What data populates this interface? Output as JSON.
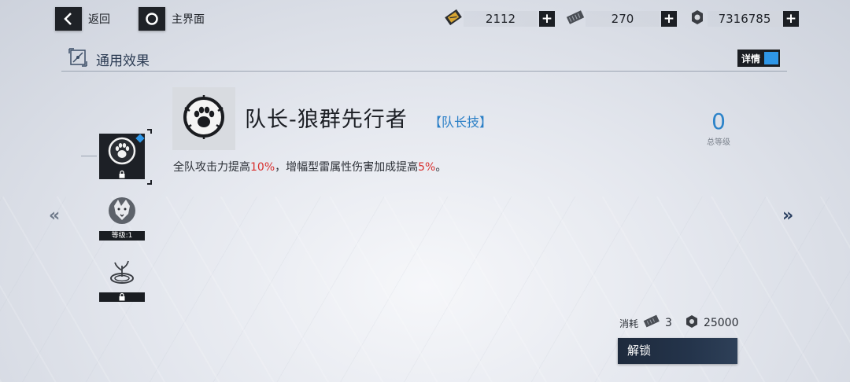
{
  "topbar": {
    "back_label": "返回",
    "home_label": "主界面",
    "resources": [
      {
        "icon": "ticket-icon",
        "value": "2112"
      },
      {
        "icon": "alloy-plate-icon",
        "value": "270"
      },
      {
        "icon": "gear-coin-icon",
        "value": "7316785"
      }
    ]
  },
  "section": {
    "title": "通用效果",
    "toggle_label": "详情"
  },
  "skill": {
    "name": "队长-狼群先行者",
    "tag": "【队长技】",
    "desc_parts": [
      "全队攻击力提高",
      "10%",
      "，增幅型雷属性伤害加成提高",
      "5%",
      "。"
    ],
    "level": "0",
    "level_label": "总等级"
  },
  "skill_list": [
    {
      "icon": "wolf-paw-icon",
      "state": "locked",
      "selected": true
    },
    {
      "icon": "wolf-head-icon",
      "state_label": "等级:1",
      "selected": false
    },
    {
      "icon": "sprout-ring-icon",
      "state": "locked",
      "selected": false
    }
  ],
  "nav": {
    "prev": "«",
    "next": "»"
  },
  "cost": {
    "label": "消耗",
    "items": [
      {
        "icon": "alloy-plate-icon",
        "value": "3"
      },
      {
        "icon": "gear-coin-icon",
        "value": "25000"
      }
    ]
  },
  "unlock_label": "解锁",
  "colors": {
    "accent_blue": "#2c83c9",
    "highlight_red": "#d8302f",
    "dark": "#1d2026"
  }
}
